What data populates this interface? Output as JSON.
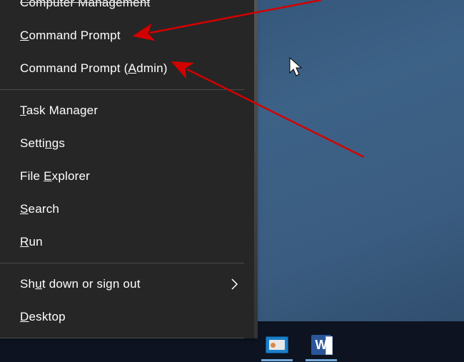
{
  "menu": {
    "items": [
      {
        "pre": "",
        "mn": "",
        "post": "Computer Management",
        "struck": true
      },
      {
        "pre": "",
        "mn": "C",
        "post": "ommand Prompt"
      },
      {
        "pre": "Command Prompt (",
        "mn": "A",
        "post": "dmin)"
      },
      {
        "pre": "",
        "mn": "T",
        "post": "ask Manager"
      },
      {
        "pre": "Setti",
        "mn": "n",
        "post": "gs"
      },
      {
        "pre": "File ",
        "mn": "E",
        "post": "xplorer"
      },
      {
        "pre": "",
        "mn": "S",
        "post": "earch"
      },
      {
        "pre": "",
        "mn": "R",
        "post": "un"
      },
      {
        "pre": "Sh",
        "mn": "u",
        "post": "t down or sign out",
        "submenu": true
      },
      {
        "pre": "",
        "mn": "D",
        "post": "esktop"
      }
    ]
  },
  "taskbar": {
    "word_glyph": "W"
  }
}
